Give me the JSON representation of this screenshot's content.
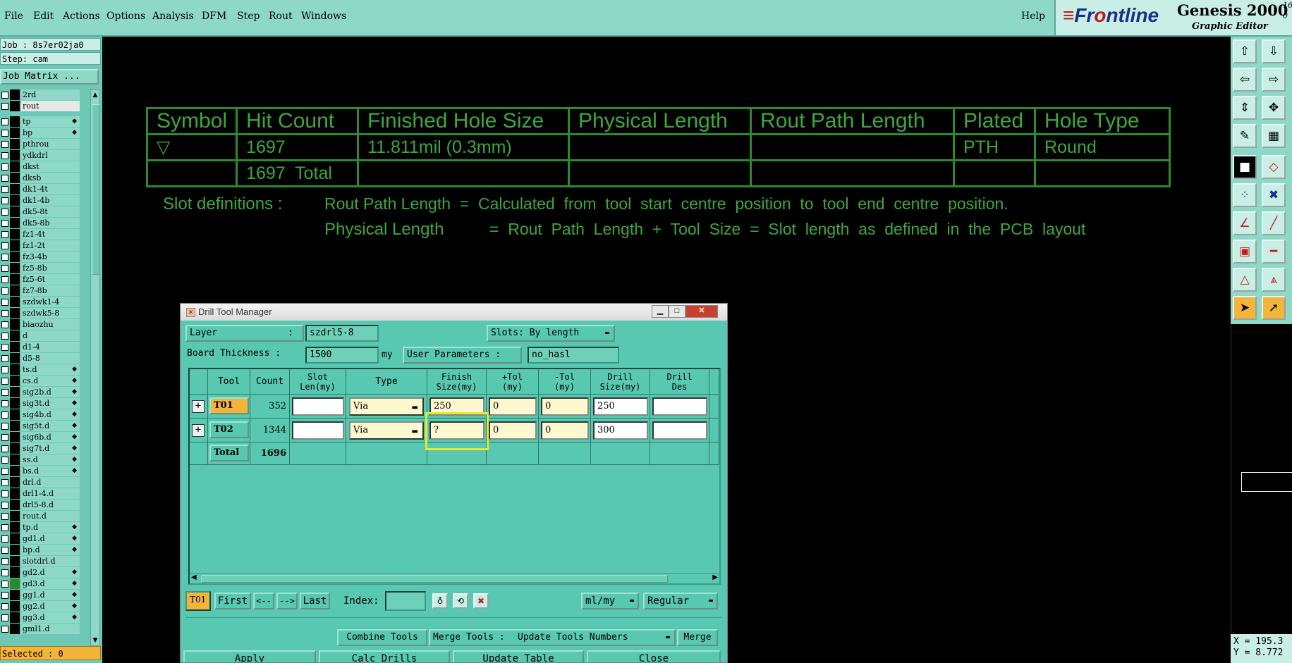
{
  "menubar": {
    "items": [
      "File",
      "Edit",
      "Actions",
      "Options",
      "Analysis",
      "DFM",
      "Step",
      "Rout",
      "Windows"
    ],
    "help": "Help"
  },
  "logo": {
    "brand_a": "Fr",
    "brand_b": "o",
    "brand_c": "ntline",
    "product": "Genesis 2000",
    "subtitle": "Graphic Editor",
    "version_a": "16",
    "version_b": "0"
  },
  "left": {
    "job": "Job : 8s7er02ja0",
    "step": "Step: cam",
    "job_matrix": "Job Matrix ...",
    "selected": "Selected : 0",
    "layers": [
      {
        "name": "2rd",
        "color": "#000000",
        "flag": ""
      },
      {
        "name": "rout",
        "color": "#000000",
        "flag": "",
        "selected": true
      },
      {
        "name": "tp",
        "color": "#000000",
        "flag": "◆"
      },
      {
        "name": "bp",
        "color": "#000000",
        "flag": "◆"
      },
      {
        "name": "pthrou",
        "color": "#000000",
        "flag": ""
      },
      {
        "name": "ydkdrl",
        "color": "#000000",
        "flag": ""
      },
      {
        "name": "dkst",
        "color": "#000000",
        "flag": ""
      },
      {
        "name": "dksb",
        "color": "#000000",
        "flag": ""
      },
      {
        "name": "dk1-4t",
        "color": "#000000",
        "flag": ""
      },
      {
        "name": "dk1-4b",
        "color": "#000000",
        "flag": ""
      },
      {
        "name": "dk5-8t",
        "color": "#000000",
        "flag": ""
      },
      {
        "name": "dk5-8b",
        "color": "#000000",
        "flag": ""
      },
      {
        "name": "fz1-4t",
        "color": "#000000",
        "flag": ""
      },
      {
        "name": "fz1-2t",
        "color": "#000000",
        "flag": ""
      },
      {
        "name": "fz3-4b",
        "color": "#000000",
        "flag": ""
      },
      {
        "name": "fz5-8b",
        "color": "#000000",
        "flag": ""
      },
      {
        "name": "fz5-6t",
        "color": "#000000",
        "flag": ""
      },
      {
        "name": "fz7-8b",
        "color": "#000000",
        "flag": ""
      },
      {
        "name": "szdwk1-4",
        "color": "#000000",
        "flag": ""
      },
      {
        "name": "szdwk5-8",
        "color": "#000000",
        "flag": ""
      },
      {
        "name": "biaozhu",
        "color": "#000000",
        "flag": ""
      },
      {
        "name": "d",
        "color": "#000000",
        "flag": ""
      },
      {
        "name": "d1-4",
        "color": "#000000",
        "flag": ""
      },
      {
        "name": "d5-8",
        "color": "#000000",
        "flag": ""
      },
      {
        "name": "ts.d",
        "color": "#000000",
        "flag": "◆"
      },
      {
        "name": "cs.d",
        "color": "#000000",
        "flag": "◆"
      },
      {
        "name": "sig2b.d",
        "color": "#000000",
        "flag": "◆"
      },
      {
        "name": "sig3t.d",
        "color": "#000000",
        "flag": "◆"
      },
      {
        "name": "sig4b.d",
        "color": "#000000",
        "flag": "◆"
      },
      {
        "name": "sig5t.d",
        "color": "#000000",
        "flag": "◆"
      },
      {
        "name": "sig6b.d",
        "color": "#000000",
        "flag": "◆"
      },
      {
        "name": "sig7t.d",
        "color": "#000000",
        "flag": "◆"
      },
      {
        "name": "ss.d",
        "color": "#000000",
        "flag": "◆"
      },
      {
        "name": "bs.d",
        "color": "#000000",
        "flag": "◆"
      },
      {
        "name": "drl.d",
        "color": "#000000",
        "flag": ""
      },
      {
        "name": "drl1-4.d",
        "color": "#000000",
        "flag": ""
      },
      {
        "name": "drl5-8.d",
        "color": "#000000",
        "flag": ""
      },
      {
        "name": "rout.d",
        "color": "#000000",
        "flag": ""
      },
      {
        "name": "tp.d",
        "color": "#000000",
        "flag": "◆"
      },
      {
        "name": "gd1.d",
        "color": "#000000",
        "flag": "◆"
      },
      {
        "name": "bp.d",
        "color": "#000000",
        "flag": "◆"
      },
      {
        "name": "slotdrl.d",
        "color": "#000000",
        "flag": ""
      },
      {
        "name": "gd2.d",
        "color": "#000000",
        "flag": "◆"
      },
      {
        "name": "gd3.d",
        "color": "#2a8a2a",
        "flag": "◆"
      },
      {
        "name": "gg1.d",
        "color": "#000000",
        "flag": "◆"
      },
      {
        "name": "gg2.d",
        "color": "#000000",
        "flag": "◆"
      },
      {
        "name": "gg3.d",
        "color": "#000000",
        "flag": "◆"
      },
      {
        "name": "gml1.d",
        "color": "#000000",
        "flag": ""
      }
    ]
  },
  "canvas_table": {
    "headers": [
      "Symbol",
      "Hit Count",
      "Finished Hole Size",
      "Physical Length",
      "Rout Path Length",
      "Plated",
      "Hole Type"
    ],
    "row1": [
      "▽",
      "1697",
      "11.811mil (0.3mm)",
      "",
      "",
      "PTH",
      "Round"
    ],
    "row2": [
      "",
      "1697  Total",
      "",
      "",
      "",
      "",
      ""
    ],
    "slot_label": "Slot definitions :",
    "slot_line1": "Rout Path Length  =  Calculated  from  tool  start  centre  position  to  tool  end  centre  position.",
    "slot_line2_label": "Physical Length",
    "slot_line2": "=  Rout  Path  Length  +  Tool  Size  =  Slot  length  as  defined  in  the  PCB  layout"
  },
  "coords": {
    "x": "X = 195.3",
    "y": "Y = 8.772"
  },
  "dialog": {
    "title": "Drill Tool Manager",
    "layer_label": "Layer",
    "layer_colon": ":",
    "layer_value": "szdrl5-8",
    "slots_label": "Slots:",
    "slots_value": "By length",
    "thickness_label": "Board Thickness :",
    "thickness_value": "1500",
    "thickness_unit": "my",
    "user_params_label": "User Parameters :",
    "user_params_value": "no_hasl",
    "columns": [
      "Tool",
      "Count",
      "Slot\nLen(my)",
      "Type",
      "Finish\nSize(my)",
      "+Tol\n(my)",
      "-Tol\n(my)",
      "Drill\nSize(my)",
      "Drill\nDes"
    ],
    "rows": [
      {
        "tool": "T01",
        "count": "352",
        "slot": "",
        "type": "Via",
        "finish": "250",
        "ptol": "0",
        "mtol": "0",
        "drill": "250",
        "des": ""
      },
      {
        "tool": "T02",
        "count": "1344",
        "slot": "",
        "type": "Via",
        "finish": "?",
        "ptol": "0",
        "mtol": "0",
        "drill": "300",
        "des": ""
      }
    ],
    "total_label": "Total",
    "total_count": "1696",
    "current_tool": "T01",
    "nav": [
      "First",
      "<--",
      "-->",
      "Last"
    ],
    "index_label": "Index:",
    "units_value": "ml/my",
    "mode_value": "Regular",
    "combine": "Combine Tools",
    "merge_label": "Merge Tools :",
    "merge_value": "Update Tools Numbers",
    "merge_btn": "Merge",
    "bottom_buttons": [
      "Apply",
      "Calc Drills",
      "Update Table",
      "Close"
    ],
    "highlight_color": "#e8e830"
  }
}
